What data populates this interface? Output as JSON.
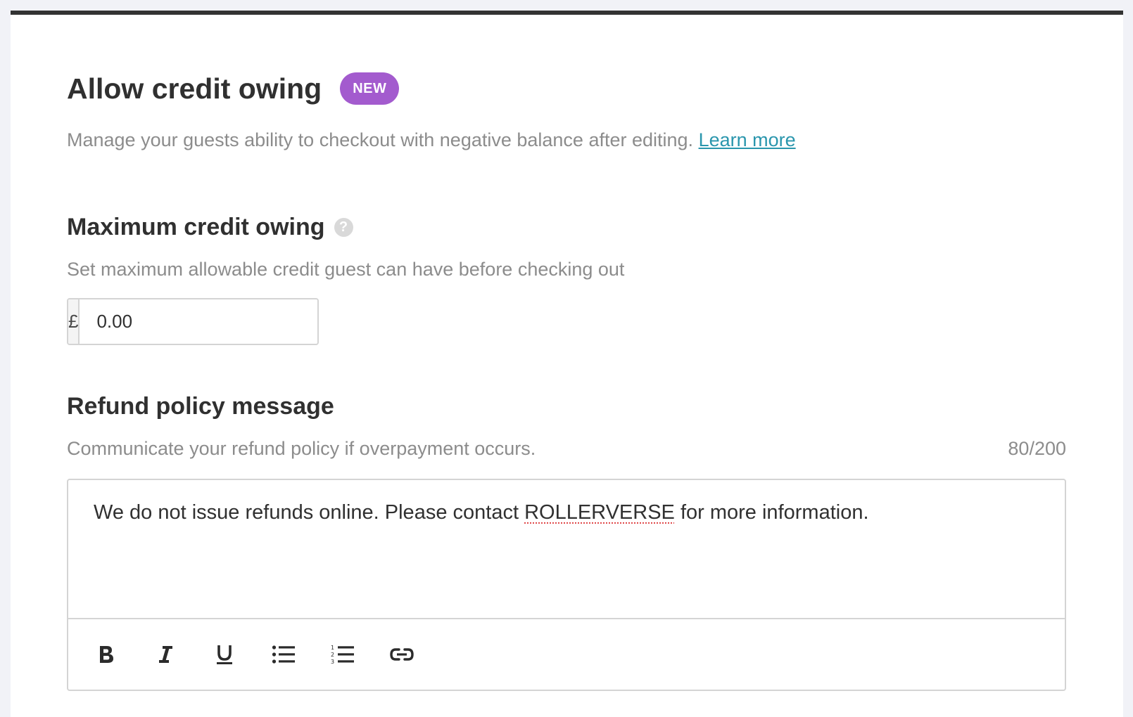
{
  "header": {
    "title": "Allow credit owing",
    "badge": "NEW",
    "subtitle": "Manage your guests ability to checkout with negative balance after editing.",
    "learn_more": "Learn more"
  },
  "max_credit": {
    "title": "Maximum credit owing",
    "help_glyph": "?",
    "description": "Set maximum allowable credit guest can have before checking out",
    "currency_symbol": "£",
    "value": "0.00"
  },
  "refund_policy": {
    "title": "Refund policy message",
    "description": "Communicate your refund policy if overpayment occurs.",
    "char_count": "80/200",
    "message_before": "We do not issue refunds online. Please contact ",
    "message_flagged": "ROLLERVERSE",
    "message_after": " for more information.",
    "toolbar": [
      "bold-icon",
      "italic-icon",
      "underline-icon",
      "bullet-list-icon",
      "numbered-list-icon",
      "link-icon"
    ]
  },
  "colors": {
    "badge": "#a35bce",
    "link": "#2a96ad",
    "heading": "#303030",
    "muted": "#8c8c8c"
  }
}
